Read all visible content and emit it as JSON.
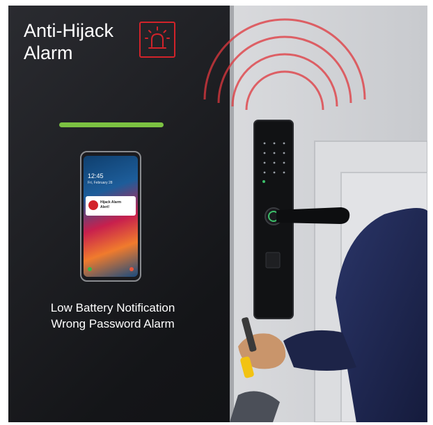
{
  "header": {
    "title_line1": "Anti-Hijack",
    "title_line2": "Alarm",
    "alarm_icon": "siren-icon",
    "accent_color": "#d2232a"
  },
  "phone": {
    "clock": "12:45",
    "date": "Fri, February 28",
    "notification_line1": "Hijack Alarm",
    "notification_line2": "Alert!"
  },
  "caption": {
    "line1": "Low Battery Notification",
    "line2": "Wrong Password Alarm"
  },
  "colors": {
    "status_bar": "#7cc242",
    "alarm_waves": "#e0383e"
  }
}
